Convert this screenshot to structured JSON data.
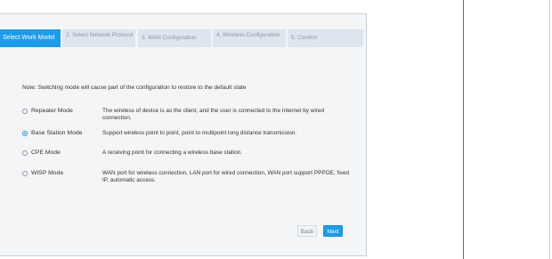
{
  "wizard": {
    "steps": [
      "Select Work Model",
      "2. Select Network Protocol",
      "3. WAN Configuration",
      "4. Wireless Configuration",
      "5. Confirm"
    ],
    "note": "Note: Switching mode will cause part of the configuration to restore to the default state",
    "modes": [
      {
        "name": "Repeater Mode",
        "description": "The wireless of device is as the client, and the user is connected to the Internet by wired connection.",
        "selected": false
      },
      {
        "name": "Base Station Mode",
        "description": "Support wireless point to point, point to multipoint long distance transmission.",
        "selected": true
      },
      {
        "name": "CPE Mode",
        "description": "A receiving point for connecting a wireless base station.",
        "selected": false
      },
      {
        "name": "WISP Mode",
        "description": "WAN port for wireless connection, LAN port for wired connection, WAN port support PPPOE, fixed IP, automatic access.",
        "selected": false
      }
    ],
    "buttons": {
      "back": "Back",
      "next": "Next"
    }
  },
  "colors": {
    "accent": "#1e9be6",
    "step_inactive_bg": "#dde5ee",
    "panel_bg": "#f4f5f7"
  }
}
